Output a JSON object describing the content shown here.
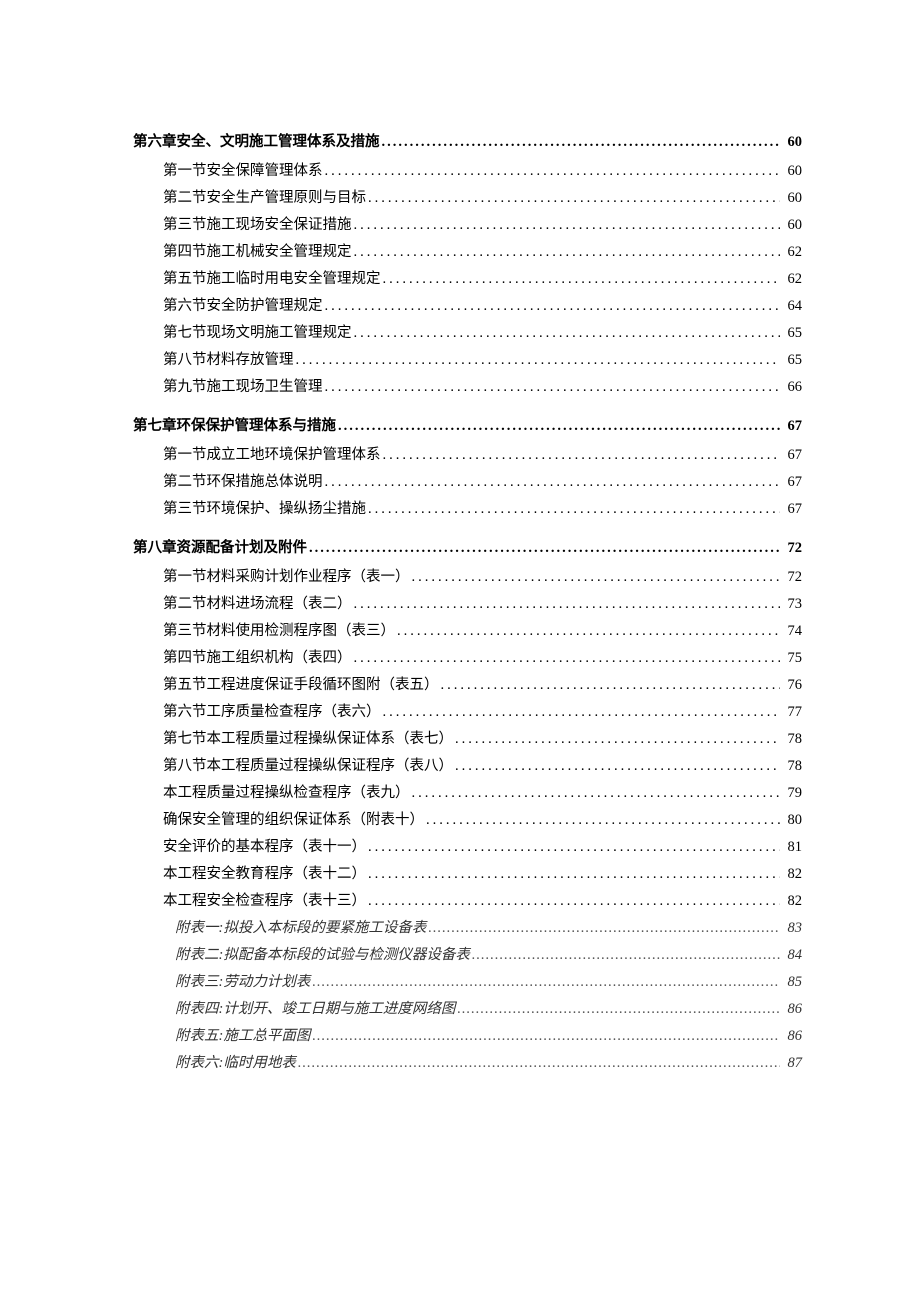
{
  "toc": [
    {
      "level": "chapter",
      "label": "第六章安全、文明施工管理体系及措施",
      "page": "60"
    },
    {
      "level": "section",
      "label": "第一节安全保障管理体系",
      "page": "60"
    },
    {
      "level": "section",
      "label": "第二节安全生产管理原则与目标",
      "page": "60"
    },
    {
      "level": "section",
      "label": "第三节施工现场安全保证措施",
      "page": "60"
    },
    {
      "level": "section",
      "label": "第四节施工机械安全管理规定",
      "page": "62"
    },
    {
      "level": "section",
      "label": "第五节施工临时用电安全管理规定",
      "page": "62"
    },
    {
      "level": "section",
      "label": "第六节安全防护管理规定",
      "page": "64"
    },
    {
      "level": "section",
      "label": "第七节现场文明施工管理规定",
      "page": "65"
    },
    {
      "level": "section",
      "label": "第八节材料存放管理",
      "page": "65"
    },
    {
      "level": "section",
      "label": "第九节施工现场卫生管理",
      "page": "66"
    },
    {
      "level": "chapter",
      "label": "第七章环保保护管理体系与措施",
      "page": "67"
    },
    {
      "level": "section",
      "label": "第一节成立工地环境保护管理体系",
      "page": "67"
    },
    {
      "level": "section",
      "label": "第二节环保措施总体说明",
      "page": "67"
    },
    {
      "level": "section",
      "label": "第三节环境保护、操纵扬尘措施",
      "page": "67"
    },
    {
      "level": "chapter",
      "label": "第八章资源配备计划及附件",
      "page": "72"
    },
    {
      "level": "section",
      "label": "第一节材料采购计划作业程序（表一）",
      "page": "72"
    },
    {
      "level": "section",
      "label": "第二节材料进场流程（表二）",
      "page": "73"
    },
    {
      "level": "section",
      "label": "第三节材料使用检测程序图（表三）",
      "page": "74"
    },
    {
      "level": "section",
      "label": "第四节施工组织机构（表四）",
      "page": "75"
    },
    {
      "level": "section",
      "label": "第五节工程进度保证手段循环图附（表五）",
      "page": "76"
    },
    {
      "level": "section",
      "label": "第六节工序质量检查程序（表六）",
      "page": "77"
    },
    {
      "level": "section",
      "label": "第七节本工程质量过程操纵保证体系（表七）",
      "page": "78"
    },
    {
      "level": "section",
      "label": "第八节本工程质量过程操纵保证程序（表八）",
      "page": "78"
    },
    {
      "level": "section",
      "label": "本工程质量过程操纵检查程序（表九）",
      "page": "79"
    },
    {
      "level": "section",
      "label": "确保安全管理的组织保证体系（附表十）",
      "page": "80"
    },
    {
      "level": "section",
      "label": "安全评价的基本程序（表十一）",
      "page": "81"
    },
    {
      "level": "section",
      "label": "本工程安全教育程序（表十二）",
      "page": "82"
    },
    {
      "level": "section",
      "label": "本工程安全检查程序（表十三）",
      "page": "82"
    },
    {
      "level": "attachment",
      "label": "附表一:拟投入本标段的要紧施工设备表",
      "page": "83"
    },
    {
      "level": "attachment",
      "label": "附表二:拟配备本标段的试验与检测仪器设备表",
      "page": "84"
    },
    {
      "level": "attachment",
      "label": "附表三:劳动力计划表",
      "page": "85"
    },
    {
      "level": "attachment",
      "label": "附表四:计划开、竣工日期与施工进度网络图",
      "page": "86"
    },
    {
      "level": "attachment",
      "label": "附表五:施工总平面图",
      "page": "86"
    },
    {
      "level": "attachment",
      "label": "附表六:临时用地表",
      "page": "87"
    }
  ]
}
